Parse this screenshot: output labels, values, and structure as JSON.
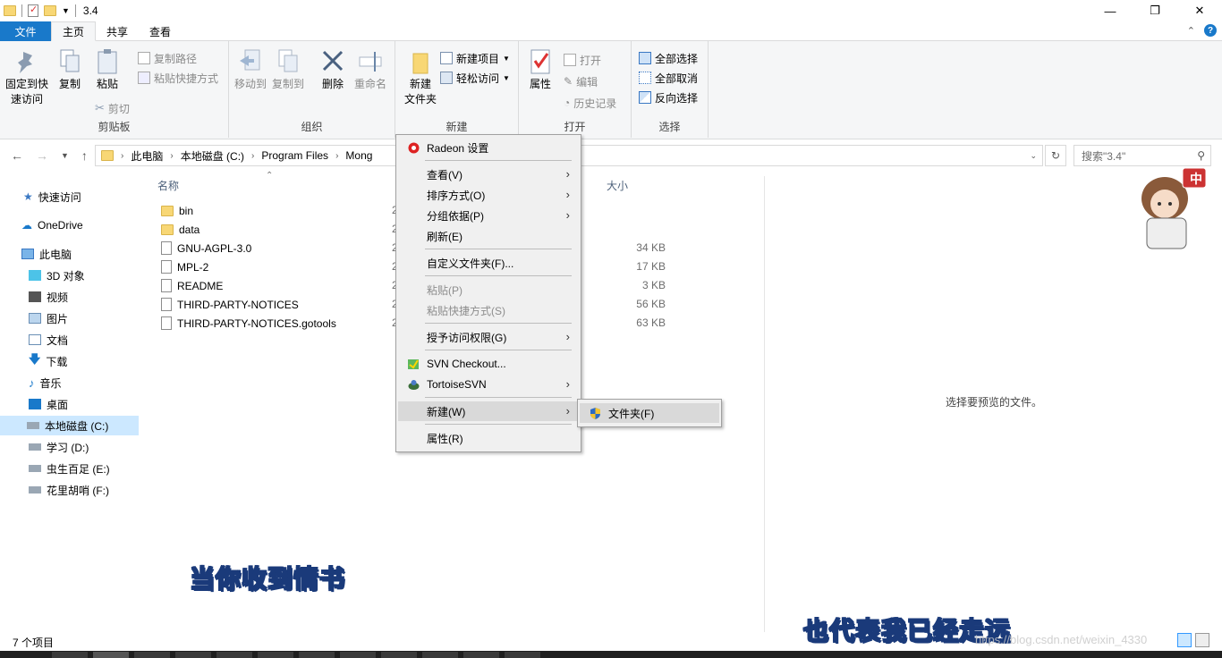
{
  "window": {
    "title": "3.4"
  },
  "tabs": {
    "file": "文件",
    "home": "主页",
    "share": "共享",
    "view": "查看"
  },
  "ribbon": {
    "clipboard": {
      "label": "剪贴板",
      "pin": "固定到快速访问",
      "pin_line1": "固定到快",
      "pin_line2": "速访问",
      "copy": "复制",
      "paste": "粘贴",
      "copy_path": "复制路径",
      "paste_shortcut": "粘贴快捷方式",
      "cut": "剪切"
    },
    "organize": {
      "label": "组织",
      "move_to": "移动到",
      "copy_to": "复制到",
      "delete": "删除",
      "rename": "重命名"
    },
    "new": {
      "label": "新建",
      "new_item": "新建项目",
      "easy_access": "轻松访问",
      "new_folder_line1": "新建",
      "new_folder_line2": "文件夹"
    },
    "open": {
      "label": "打开",
      "properties": "属性",
      "open": "打开",
      "edit": "编辑",
      "history": "历史记录"
    },
    "select": {
      "label": "选择",
      "select_all": "全部选择",
      "select_none": "全部取消",
      "invert": "反向选择"
    }
  },
  "address": {
    "crumbs": [
      "此电脑",
      "本地磁盘 (C:)",
      "Program Files",
      "Mong"
    ],
    "search_placeholder": "搜索\"3.4\""
  },
  "nav": {
    "quick_access": "快速访问",
    "onedrive": "OneDrive",
    "this_pc": "此电脑",
    "objects3d": "3D 对象",
    "videos": "视频",
    "pictures": "图片",
    "documents": "文档",
    "downloads": "下载",
    "music": "音乐",
    "desktop": "桌面",
    "drive_c": "本地磁盘 (C:)",
    "drive_d": "学习 (D:)",
    "drive_e": "虫生百足 (E:)",
    "drive_f": "花里胡哨 (F:)"
  },
  "columns": {
    "name": "名称",
    "size": "大小"
  },
  "files": [
    {
      "name": "bin",
      "type": "folder",
      "size": ""
    },
    {
      "name": "data",
      "type": "folder",
      "size": ""
    },
    {
      "name": "GNU-AGPL-3.0",
      "type": "file",
      "size": "34 KB"
    },
    {
      "name": "MPL-2",
      "type": "file",
      "size": "17 KB"
    },
    {
      "name": "README",
      "type": "file",
      "size": "3 KB"
    },
    {
      "name": "THIRD-PARTY-NOTICES",
      "type": "file",
      "size": "56 KB"
    },
    {
      "name": "THIRD-PARTY-NOTICES.gotools",
      "type": "file",
      "size": "63 KB"
    }
  ],
  "date_stub": "2",
  "context_menu": {
    "radeon": "Radeon 设置",
    "view": "查看(V)",
    "sort": "排序方式(O)",
    "group": "分组依据(P)",
    "refresh": "刷新(E)",
    "customize": "自定义文件夹(F)...",
    "paste": "粘贴(P)",
    "paste_shortcut": "粘贴快捷方式(S)",
    "grant_access": "授予访问权限(G)",
    "svn_checkout": "SVN Checkout...",
    "tortoise": "TortoiseSVN",
    "new": "新建(W)",
    "properties": "属性(R)"
  },
  "submenu": {
    "folder": "文件夹(F)"
  },
  "preview": {
    "text": "选择要预览的文件。"
  },
  "status": {
    "count": "7 个项目"
  },
  "overlay": {
    "lyric1": "当你收到情书",
    "lyric2": "也代表我已经走远",
    "watermark": "https://blog.csdn.net/weixin_4330",
    "ime_badge": "中"
  },
  "colors": {
    "accent": "#1979ca",
    "folder": "#f8d775",
    "selection": "#cce8ff"
  }
}
